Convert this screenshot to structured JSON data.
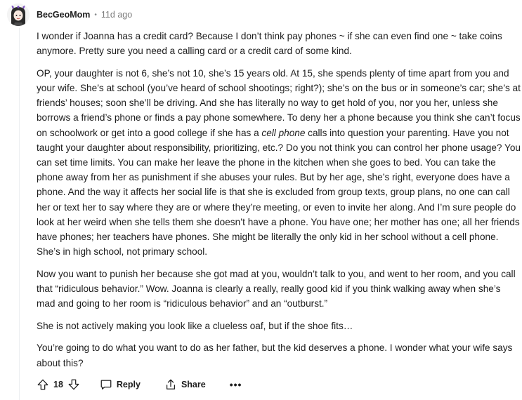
{
  "comment": {
    "author": "BecGeoMom",
    "separator": "•",
    "timestamp": "11d ago",
    "paragraphs": [
      "I wonder if Joanna has a credit card? Because I don’t think pay phones ~ if she can even find one ~ take coins anymore. Pretty sure you need a calling card or a credit card of some kind.",
      {
        "before": "OP, your daughter is not 6, she’s not 10, she’s 15 years old. At 15, she spends plenty of time apart from you and your wife. She’s at school (you’ve heard of school shootings; right?); she’s on the bus or in someone’s car; she’s at friends’ houses; soon she’ll be driving. And she has literally no way to get hold of you, nor you her, unless she borrows a friend’s phone or finds a pay phone somewhere. To deny her a phone because you think she can’t focus on schoolwork or get into a good college if she has a ",
        "emphasis": "cell phone",
        "after": " calls into question your parenting. Have you not taught your daughter about responsibility, prioritizing, etc.? Do you not think you can control her phone usage? You can set time limits. You can make her leave the phone in the kitchen when she goes to bed. You can take the phone away from her as punishment if she abuses your rules. But by her age, she’s right, everyone does have a phone. And the way it affects her social life is that she is excluded from group texts, group plans, no one can call her or text her to say where they are or where they’re meeting, or even to invite her along. And I’m sure people do look at her weird when she tells them she doesn’t have a phone. You have one; her mother has one; all her friends have phones; her teachers have phones. She might be literally the only kid in her school without a cell phone. She’s in high school, not primary school."
      },
      "Now you want to punish her because she got mad at you, wouldn’t talk to you, and went to her room, and you call that “ridiculous behavior.” Wow. Joanna is clearly a really, really good kid if you think walking away when she’s mad and going to her room is “ridiculous behavior” and an “outburst.”",
      "She is not actively making you look like a clueless oaf, but if the shoe fits…",
      "You’re going to do what you want to do as her father, but the kid deserves a phone. I wonder what your wife says about this?"
    ]
  },
  "actions": {
    "upvote_icon": "upvote-arrow-icon",
    "vote_count": "18",
    "downvote_icon": "downvote-arrow-icon",
    "reply_icon": "speech-bubble-icon",
    "reply_label": "Reply",
    "share_icon": "share-icon",
    "share_label": "Share",
    "more_label": "•••"
  },
  "colors": {
    "text": "#1c1c1c",
    "meta": "#7c7c7c",
    "avatar_hair": "#2a2a2a",
    "avatar_bow": "#7b4fbf"
  }
}
